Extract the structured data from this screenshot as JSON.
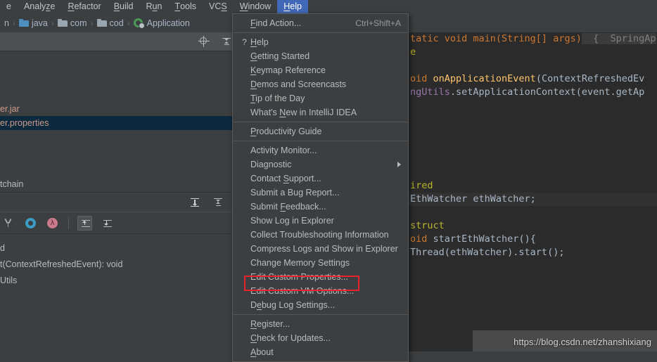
{
  "menubar": {
    "items": [
      {
        "label": "e",
        "mnemonic": "",
        "active": false
      },
      {
        "label": "Analyze",
        "mnemonic": "z",
        "active": false
      },
      {
        "label": "Refactor",
        "mnemonic": "R",
        "active": false
      },
      {
        "label": "Build",
        "mnemonic": "B",
        "active": false
      },
      {
        "label": "Run",
        "mnemonic": "u",
        "active": false
      },
      {
        "label": "Tools",
        "mnemonic": "T",
        "active": false
      },
      {
        "label": "VCS",
        "mnemonic": "S",
        "active": false
      },
      {
        "label": "Window",
        "mnemonic": "W",
        "active": false
      },
      {
        "label": "Help",
        "mnemonic": "H",
        "active": true
      }
    ],
    "highlight_color": "#4268b8"
  },
  "breadcrumb": {
    "items": [
      {
        "label": "n",
        "icon": "none"
      },
      {
        "label": "java",
        "icon": "folder-blue"
      },
      {
        "label": "com",
        "icon": "folder-gray"
      },
      {
        "label": "cod",
        "icon": "folder-gray"
      },
      {
        "label": "Application",
        "icon": "spring-application"
      }
    ],
    "separator": "›"
  },
  "project_panel": {
    "toolbar": {
      "locate_icon": "target-crosshair-icon",
      "collapse_icon": "collapse-all-icon"
    },
    "rows": [
      {
        "label": "er.jar",
        "selected": false
      },
      {
        "label": "er.properties",
        "selected": true
      }
    ]
  },
  "structure_panel": {
    "tab_label": "tchain",
    "toolbar2": {
      "sort_icon": "sort-alpha-icon",
      "collapse_icon": "collapse-all-icon"
    },
    "toolbar": {
      "buttons": [
        {
          "name": "show-inherited-icon",
          "label": ""
        },
        {
          "name": "interface-icon",
          "label": ""
        },
        {
          "name": "lambda-icon",
          "label": "λ"
        },
        {
          "name": "expand-all-icon",
          "label": "",
          "active": true
        },
        {
          "name": "collapse-all-icon",
          "label": "",
          "active": false
        }
      ]
    },
    "rows": [
      {
        "label": "d"
      },
      {
        "label": "t(ContextRefreshedEvent): void"
      },
      {
        "label": "Utils"
      }
    ]
  },
  "editor": {
    "lines": [
      {
        "highlight": false,
        "tokens": [
          {
            "t": "tatic void main(String[] args)",
            "c": "kw-mixed"
          },
          {
            "t": "  {  SpringAp",
            "c": "hint"
          }
        ]
      },
      {
        "highlight": false,
        "tokens": [
          {
            "t": "e",
            "c": "ann"
          }
        ]
      },
      {
        "highlight": false,
        "tokens": []
      },
      {
        "highlight": false,
        "tokens": [
          {
            "t": "oid ",
            "c": "kw"
          },
          {
            "t": "onApplicationEvent",
            "c": "mth"
          },
          {
            "t": "(ContextRefreshedEv",
            "c": "id"
          }
        ]
      },
      {
        "highlight": false,
        "tokens": [
          {
            "t": "ngUtils",
            "c": "pur"
          },
          {
            "t": ".setApplicationContext(event.getAp",
            "c": "id"
          }
        ]
      },
      {
        "highlight": false,
        "tokens": []
      },
      {
        "highlight": false,
        "tokens": []
      },
      {
        "highlight": false,
        "tokens": []
      },
      {
        "highlight": false,
        "tokens": []
      },
      {
        "highlight": false,
        "tokens": []
      },
      {
        "highlight": false,
        "tokens": []
      },
      {
        "highlight": false,
        "tokens": [
          {
            "t": "ired",
            "c": "ann"
          }
        ]
      },
      {
        "highlight": true,
        "tokens": [
          {
            "t": "EthWatcher ethWatcher;",
            "c": "id"
          }
        ]
      },
      {
        "highlight": false,
        "tokens": []
      },
      {
        "highlight": false,
        "tokens": [
          {
            "t": "struct",
            "c": "ann"
          }
        ]
      },
      {
        "highlight": false,
        "tokens": [
          {
            "t": "oid ",
            "c": "kw"
          },
          {
            "t": "startEthWatcher",
            "c": "id"
          },
          {
            "t": "(){",
            "c": "brk"
          }
        ]
      },
      {
        "highlight": false,
        "tokens": [
          {
            "t": "Thread(ethWatcher).start();",
            "c": "id"
          }
        ]
      }
    ]
  },
  "help_menu": {
    "groups": [
      {
        "items": [
          {
            "label": "Find Action...",
            "mnemonic": "F",
            "accel": "Ctrl+Shift+A",
            "glyph": "",
            "submenu": false,
            "highlighted": false
          }
        ]
      },
      {
        "items": [
          {
            "label": "Help",
            "mnemonic": "H",
            "accel": "",
            "glyph": "?",
            "submenu": false,
            "highlighted": false
          },
          {
            "label": "Getting Started",
            "mnemonic": "G",
            "accel": "",
            "glyph": "",
            "submenu": false,
            "highlighted": false
          },
          {
            "label": "Keymap Reference",
            "mnemonic": "K",
            "accel": "",
            "glyph": "",
            "submenu": false,
            "highlighted": false
          },
          {
            "label": "Demos and Screencasts",
            "mnemonic": "D",
            "accel": "",
            "glyph": "",
            "submenu": false,
            "highlighted": false
          },
          {
            "label": "Tip of the Day",
            "mnemonic": "T",
            "accel": "",
            "glyph": "",
            "submenu": false,
            "highlighted": false
          },
          {
            "label": "What's New in IntelliJ IDEA",
            "mnemonic": "N",
            "accel": "",
            "glyph": "",
            "submenu": false,
            "highlighted": false
          }
        ]
      },
      {
        "items": [
          {
            "label": "Productivity Guide",
            "mnemonic": "P",
            "accel": "",
            "glyph": "",
            "submenu": false,
            "highlighted": false
          }
        ]
      },
      {
        "items": [
          {
            "label": "Activity Monitor...",
            "mnemonic": "",
            "accel": "",
            "glyph": "",
            "submenu": false,
            "highlighted": false
          },
          {
            "label": "Diagnostic",
            "mnemonic": "",
            "accel": "",
            "glyph": "",
            "submenu": true,
            "highlighted": false
          },
          {
            "label": "Contact Support...",
            "mnemonic": "S",
            "accel": "",
            "glyph": "",
            "submenu": false,
            "highlighted": false
          },
          {
            "label": "Submit a Bug Report...",
            "mnemonic": "",
            "accel": "",
            "glyph": "",
            "submenu": false,
            "highlighted": false
          },
          {
            "label": "Submit Feedback...",
            "mnemonic": "F",
            "accel": "",
            "glyph": "",
            "submenu": false,
            "highlighted": false
          },
          {
            "label": "Show Log in Explorer",
            "mnemonic": "",
            "accel": "",
            "glyph": "",
            "submenu": false,
            "highlighted": false
          },
          {
            "label": "Collect Troubleshooting Information",
            "mnemonic": "",
            "accel": "",
            "glyph": "",
            "submenu": false,
            "highlighted": false
          },
          {
            "label": "Compress Logs and Show in Explorer",
            "mnemonic": "",
            "accel": "",
            "glyph": "",
            "submenu": false,
            "highlighted": false
          },
          {
            "label": "Change Memory Settings",
            "mnemonic": "",
            "accel": "",
            "glyph": "",
            "submenu": false,
            "highlighted": false
          },
          {
            "label": "Edit Custom Properties...",
            "mnemonic": "",
            "accel": "",
            "glyph": "",
            "submenu": false,
            "highlighted": false
          },
          {
            "label": "Edit Custom VM Options...",
            "mnemonic": "",
            "accel": "",
            "glyph": "",
            "submenu": false,
            "highlighted": true
          },
          {
            "label": "Debug Log Settings...",
            "mnemonic": "e",
            "accel": "",
            "glyph": "",
            "submenu": false,
            "highlighted": false
          }
        ]
      },
      {
        "items": [
          {
            "label": "Register...",
            "mnemonic": "R",
            "accel": "",
            "glyph": "",
            "submenu": false,
            "highlighted": false
          },
          {
            "label": "Check for Updates...",
            "mnemonic": "C",
            "accel": "",
            "glyph": "",
            "submenu": false,
            "highlighted": false
          },
          {
            "label": "About",
            "mnemonic": "A",
            "accel": "",
            "glyph": "",
            "submenu": false,
            "highlighted": false
          }
        ]
      }
    ],
    "annotation_color": "#e8222a"
  },
  "watermark": {
    "text": "https://blog.csdn.net/zhanshixiang"
  }
}
